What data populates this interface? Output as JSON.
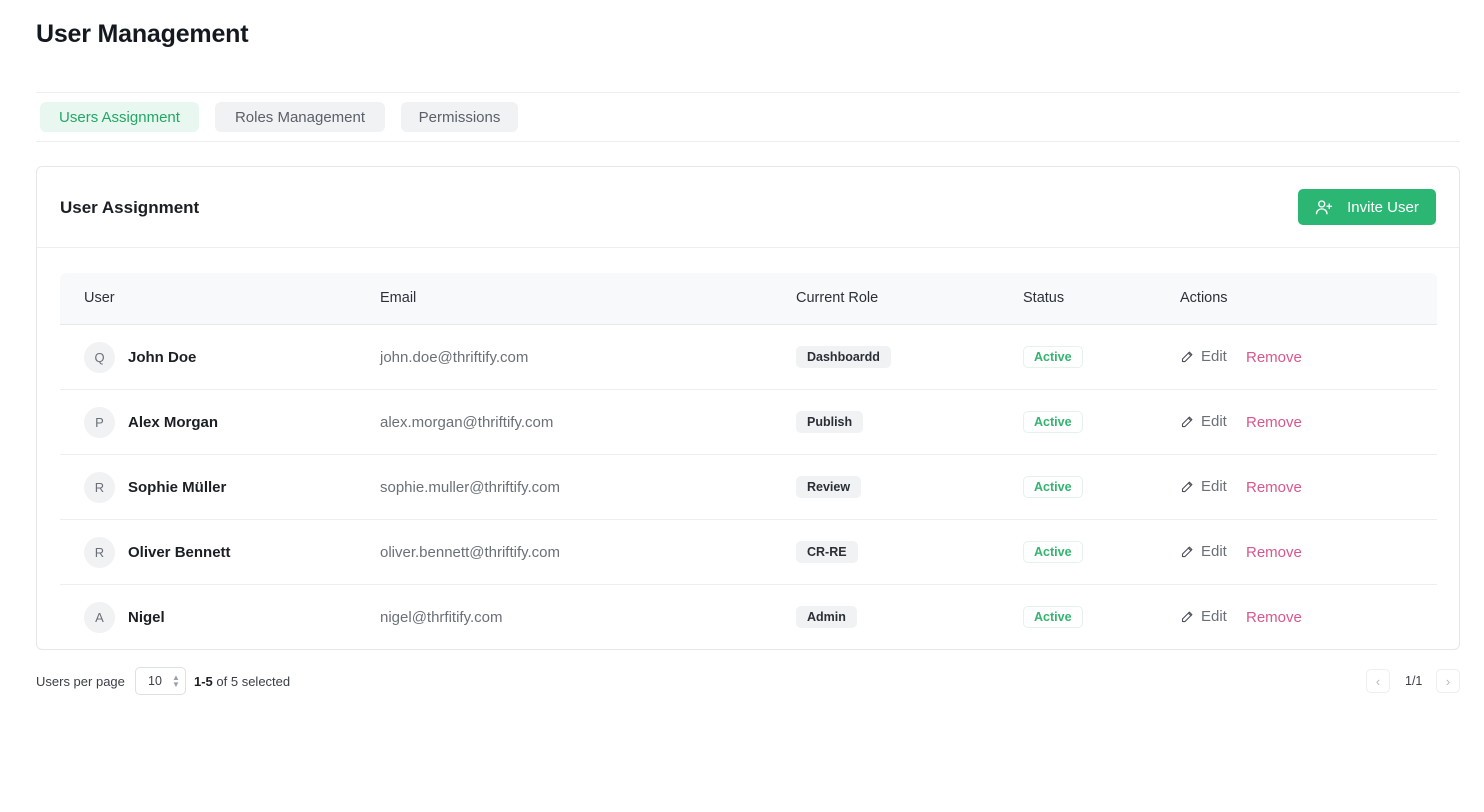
{
  "page": {
    "title": "User Management"
  },
  "tabs": [
    {
      "label": "Users Assignment",
      "active": true
    },
    {
      "label": "Roles Management",
      "active": false
    },
    {
      "label": "Permissions",
      "active": false
    }
  ],
  "card": {
    "title": "User Assignment",
    "invite_label": "Invite User",
    "invite_icon": "user-plus-icon"
  },
  "table": {
    "headers": [
      "User",
      "Email",
      "Current Role",
      "Status",
      "Actions"
    ],
    "rows": [
      {
        "initial": "Q",
        "name": "John Doe",
        "email": "john.doe@thriftify.com",
        "role": "Dashboardd",
        "status": "Active",
        "edit": "Edit",
        "remove": "Remove"
      },
      {
        "initial": "P",
        "name": "Alex Morgan",
        "email": "alex.morgan@thriftify.com",
        "role": "Publish",
        "status": "Active",
        "edit": "Edit",
        "remove": "Remove"
      },
      {
        "initial": "R",
        "name": "Sophie Müller",
        "email": "sophie.muller@thriftify.com",
        "role": "Review",
        "status": "Active",
        "edit": "Edit",
        "remove": "Remove"
      },
      {
        "initial": "R",
        "name": "Oliver Bennett",
        "email": "oliver.bennett@thriftify.com",
        "role": "CR-RE",
        "status": "Active",
        "edit": "Edit",
        "remove": "Remove"
      },
      {
        "initial": "A",
        "name": "Nigel",
        "email": "nigel@thrfitify.com",
        "role": "Admin",
        "status": "Active",
        "edit": "Edit",
        "remove": "Remove"
      }
    ]
  },
  "pagination": {
    "per_page_label": "Users per page",
    "per_page_value": "10",
    "range_bold": "1-5",
    "range_rest": " of 5 selected",
    "page_label": "1/1",
    "prev_icon": "chevron-left-icon",
    "next_icon": "chevron-right-icon"
  },
  "colors": {
    "accent": "#2cb673",
    "active_tab_bg": "#e8f7ef",
    "active_tab_text": "#25a667",
    "remove": "#d6588e",
    "status_text": "#33b46f"
  }
}
